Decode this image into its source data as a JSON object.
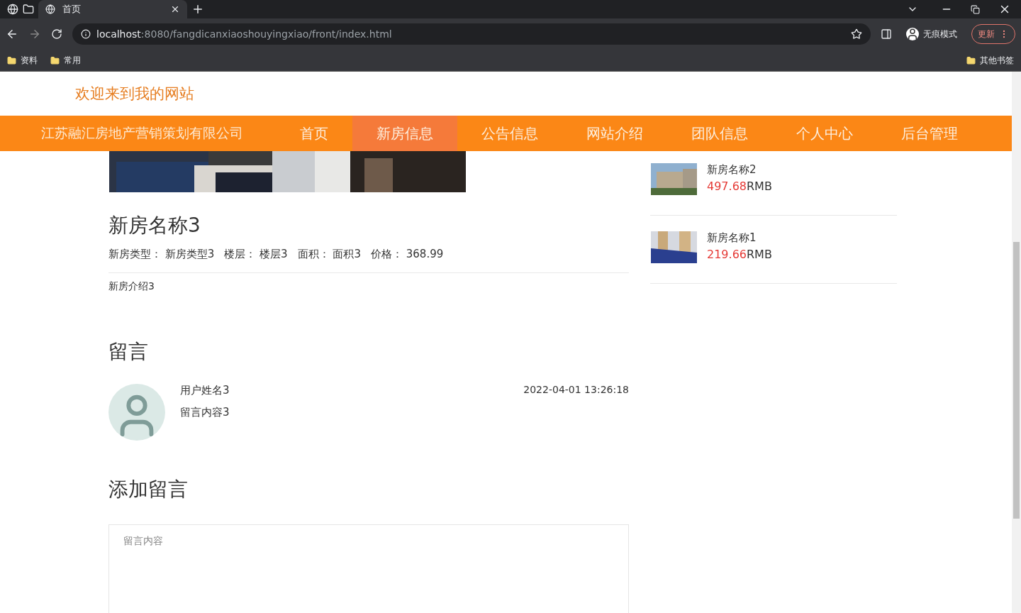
{
  "browser": {
    "tabs": [
      {
        "title": "首页",
        "selected": true
      }
    ],
    "url_host": "localhost",
    "url_path": ":8080/fangdicanxiaoshouyingxiao/front/index.html",
    "profile_label": "无痕模式",
    "update_button": "更新",
    "bookmarks": [
      "资料",
      "常用"
    ],
    "other_bookmarks": "其他书签"
  },
  "page": {
    "welcome": "欢迎来到我的网站",
    "nav": {
      "brand": "江苏融汇房地产营销策划有限公司",
      "items": [
        {
          "label": "首页",
          "selected": false
        },
        {
          "label": "新房信息",
          "selected": true
        },
        {
          "label": "公告信息",
          "selected": false
        },
        {
          "label": "网站介绍",
          "selected": false
        },
        {
          "label": "团队信息",
          "selected": false
        },
        {
          "label": "个人中心",
          "selected": false
        },
        {
          "label": "后台管理",
          "selected": false
        }
      ]
    },
    "house": {
      "name": "新房名称3",
      "meta": [
        {
          "label": "新房类型：",
          "value": "新房类型3"
        },
        {
          "label": "楼层：",
          "value": "楼层3"
        },
        {
          "label": "面积：",
          "value": "面积3"
        },
        {
          "label": "价格：",
          "value": "368.99"
        }
      ],
      "intro": "新房介绍3"
    },
    "comments": {
      "heading": "留言",
      "items": [
        {
          "user": "用户姓名3",
          "content": "留言内容3",
          "time": "2022-04-01 13:26:18"
        }
      ]
    },
    "add_comment": {
      "heading": "添加留言",
      "placeholder": "留言内容"
    },
    "sidebar": [
      {
        "name": "新房名称2",
        "price": "497.68",
        "unit": "RMB"
      },
      {
        "name": "新房名称1",
        "price": "219.66",
        "unit": "RMB"
      }
    ]
  }
}
